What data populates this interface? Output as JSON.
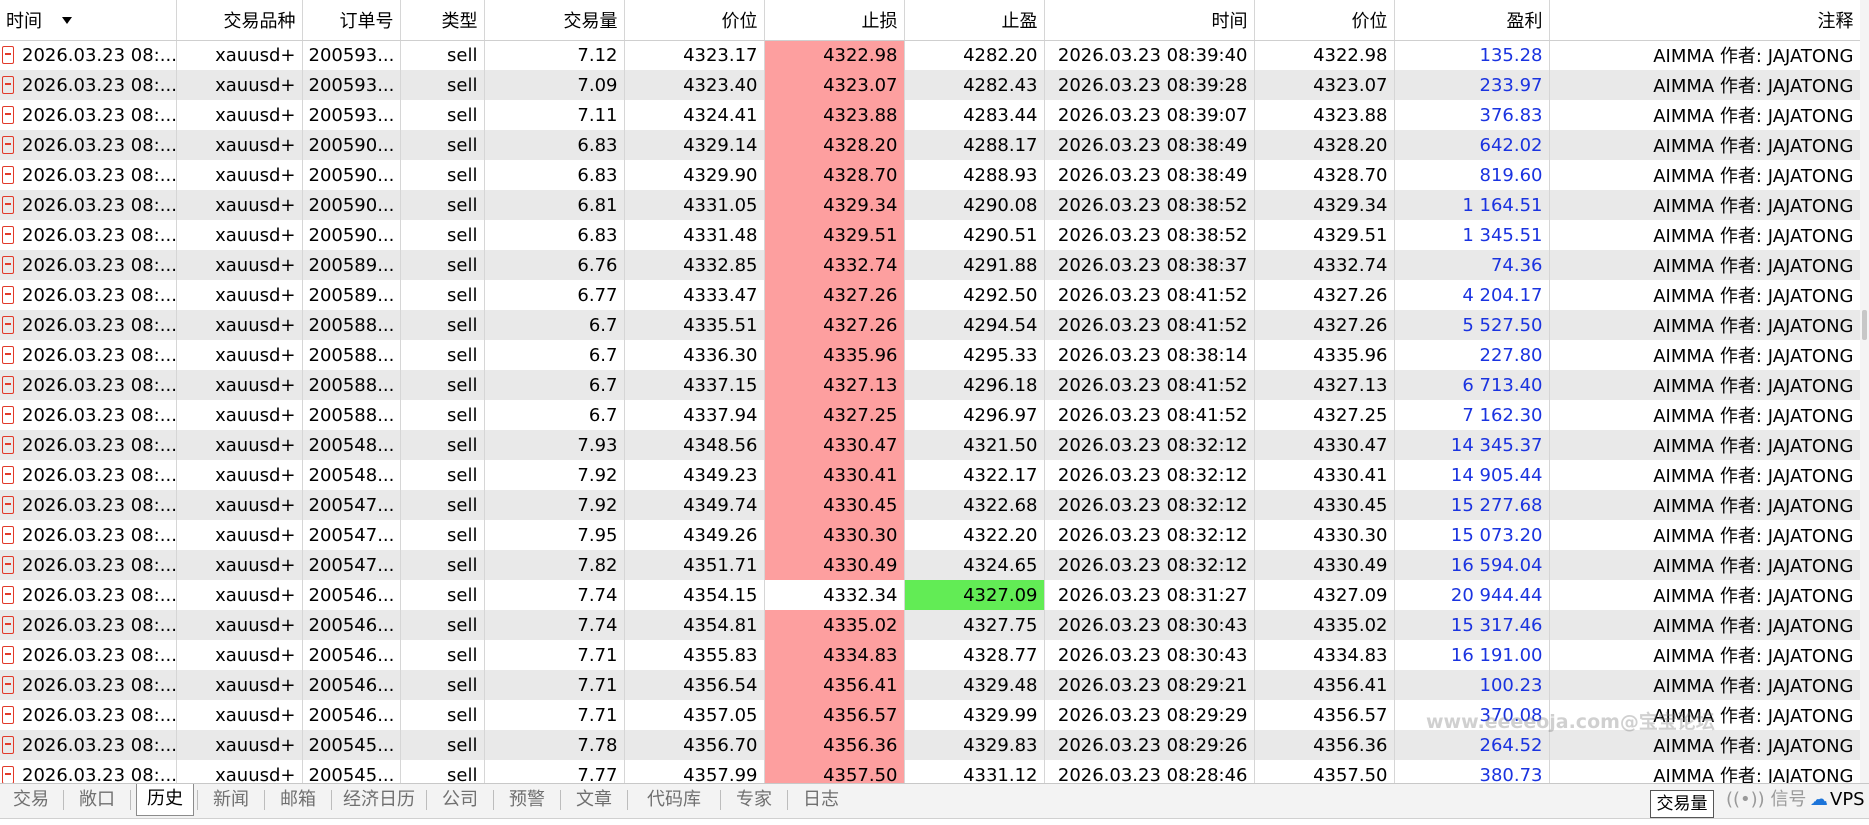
{
  "columns": [
    "时间",
    "交易品种",
    "订单号",
    "类型",
    "交易量",
    "价位",
    "止损",
    "止盈",
    "时间",
    "价位",
    "盈利",
    "注释"
  ],
  "rows": [
    {
      "open_time": "2026.03.23 08:...",
      "symbol": "xauusd+",
      "order": "200593...",
      "type": "sell",
      "volume": "7.12",
      "open_price": "4323.17",
      "sl": "4322.98",
      "tp": "4282.20",
      "close_time": "2026.03.23 08:39:40",
      "close_price": "4322.98",
      "profit": "135.28",
      "comment": "AIMMA 作者: JAJATONG",
      "sl_hit": true,
      "tp_hit": false
    },
    {
      "open_time": "2026.03.23 08:...",
      "symbol": "xauusd+",
      "order": "200593...",
      "type": "sell",
      "volume": "7.09",
      "open_price": "4323.40",
      "sl": "4323.07",
      "tp": "4282.43",
      "close_time": "2026.03.23 08:39:28",
      "close_price": "4323.07",
      "profit": "233.97",
      "comment": "AIMMA 作者: JAJATONG",
      "sl_hit": true,
      "tp_hit": false
    },
    {
      "open_time": "2026.03.23 08:...",
      "symbol": "xauusd+",
      "order": "200593...",
      "type": "sell",
      "volume": "7.11",
      "open_price": "4324.41",
      "sl": "4323.88",
      "tp": "4283.44",
      "close_time": "2026.03.23 08:39:07",
      "close_price": "4323.88",
      "profit": "376.83",
      "comment": "AIMMA 作者: JAJATONG",
      "sl_hit": true,
      "tp_hit": false
    },
    {
      "open_time": "2026.03.23 08:...",
      "symbol": "xauusd+",
      "order": "200590...",
      "type": "sell",
      "volume": "6.83",
      "open_price": "4329.14",
      "sl": "4328.20",
      "tp": "4288.17",
      "close_time": "2026.03.23 08:38:49",
      "close_price": "4328.20",
      "profit": "642.02",
      "comment": "AIMMA 作者: JAJATONG",
      "sl_hit": true,
      "tp_hit": false
    },
    {
      "open_time": "2026.03.23 08:...",
      "symbol": "xauusd+",
      "order": "200590...",
      "type": "sell",
      "volume": "6.83",
      "open_price": "4329.90",
      "sl": "4328.70",
      "tp": "4288.93",
      "close_time": "2026.03.23 08:38:49",
      "close_price": "4328.70",
      "profit": "819.60",
      "comment": "AIMMA 作者: JAJATONG",
      "sl_hit": true,
      "tp_hit": false
    },
    {
      "open_time": "2026.03.23 08:...",
      "symbol": "xauusd+",
      "order": "200590...",
      "type": "sell",
      "volume": "6.81",
      "open_price": "4331.05",
      "sl": "4329.34",
      "tp": "4290.08",
      "close_time": "2026.03.23 08:38:52",
      "close_price": "4329.34",
      "profit": "1 164.51",
      "comment": "AIMMA 作者: JAJATONG",
      "sl_hit": true,
      "tp_hit": false
    },
    {
      "open_time": "2026.03.23 08:...",
      "symbol": "xauusd+",
      "order": "200590...",
      "type": "sell",
      "volume": "6.83",
      "open_price": "4331.48",
      "sl": "4329.51",
      "tp": "4290.51",
      "close_time": "2026.03.23 08:38:52",
      "close_price": "4329.51",
      "profit": "1 345.51",
      "comment": "AIMMA 作者: JAJATONG",
      "sl_hit": true,
      "tp_hit": false
    },
    {
      "open_time": "2026.03.23 08:...",
      "symbol": "xauusd+",
      "order": "200589...",
      "type": "sell",
      "volume": "6.76",
      "open_price": "4332.85",
      "sl": "4332.74",
      "tp": "4291.88",
      "close_time": "2026.03.23 08:38:37",
      "close_price": "4332.74",
      "profit": "74.36",
      "comment": "AIMMA 作者: JAJATONG",
      "sl_hit": true,
      "tp_hit": false
    },
    {
      "open_time": "2026.03.23 08:...",
      "symbol": "xauusd+",
      "order": "200589...",
      "type": "sell",
      "volume": "6.77",
      "open_price": "4333.47",
      "sl": "4327.26",
      "tp": "4292.50",
      "close_time": "2026.03.23 08:41:52",
      "close_price": "4327.26",
      "profit": "4 204.17",
      "comment": "AIMMA 作者: JAJATONG",
      "sl_hit": true,
      "tp_hit": false
    },
    {
      "open_time": "2026.03.23 08:...",
      "symbol": "xauusd+",
      "order": "200588...",
      "type": "sell",
      "volume": "6.7",
      "open_price": "4335.51",
      "sl": "4327.26",
      "tp": "4294.54",
      "close_time": "2026.03.23 08:41:52",
      "close_price": "4327.26",
      "profit": "5 527.50",
      "comment": "AIMMA 作者: JAJATONG",
      "sl_hit": true,
      "tp_hit": false
    },
    {
      "open_time": "2026.03.23 08:...",
      "symbol": "xauusd+",
      "order": "200588...",
      "type": "sell",
      "volume": "6.7",
      "open_price": "4336.30",
      "sl": "4335.96",
      "tp": "4295.33",
      "close_time": "2026.03.23 08:38:14",
      "close_price": "4335.96",
      "profit": "227.80",
      "comment": "AIMMA 作者: JAJATONG",
      "sl_hit": true,
      "tp_hit": false
    },
    {
      "open_time": "2026.03.23 08:...",
      "symbol": "xauusd+",
      "order": "200588...",
      "type": "sell",
      "volume": "6.7",
      "open_price": "4337.15",
      "sl": "4327.13",
      "tp": "4296.18",
      "close_time": "2026.03.23 08:41:52",
      "close_price": "4327.13",
      "profit": "6 713.40",
      "comment": "AIMMA 作者: JAJATONG",
      "sl_hit": true,
      "tp_hit": false
    },
    {
      "open_time": "2026.03.23 08:...",
      "symbol": "xauusd+",
      "order": "200588...",
      "type": "sell",
      "volume": "6.7",
      "open_price": "4337.94",
      "sl": "4327.25",
      "tp": "4296.97",
      "close_time": "2026.03.23 08:41:52",
      "close_price": "4327.25",
      "profit": "7 162.30",
      "comment": "AIMMA 作者: JAJATONG",
      "sl_hit": true,
      "tp_hit": false
    },
    {
      "open_time": "2026.03.23 08:...",
      "symbol": "xauusd+",
      "order": "200548...",
      "type": "sell",
      "volume": "7.93",
      "open_price": "4348.56",
      "sl": "4330.47",
      "tp": "4321.50",
      "close_time": "2026.03.23 08:32:12",
      "close_price": "4330.47",
      "profit": "14 345.37",
      "comment": "AIMMA 作者: JAJATONG",
      "sl_hit": true,
      "tp_hit": false
    },
    {
      "open_time": "2026.03.23 08:...",
      "symbol": "xauusd+",
      "order": "200548...",
      "type": "sell",
      "volume": "7.92",
      "open_price": "4349.23",
      "sl": "4330.41",
      "tp": "4322.17",
      "close_time": "2026.03.23 08:32:12",
      "close_price": "4330.41",
      "profit": "14 905.44",
      "comment": "AIMMA 作者: JAJATONG",
      "sl_hit": true,
      "tp_hit": false
    },
    {
      "open_time": "2026.03.23 08:...",
      "symbol": "xauusd+",
      "order": "200547...",
      "type": "sell",
      "volume": "7.92",
      "open_price": "4349.74",
      "sl": "4330.45",
      "tp": "4322.68",
      "close_time": "2026.03.23 08:32:12",
      "close_price": "4330.45",
      "profit": "15 277.68",
      "comment": "AIMMA 作者: JAJATONG",
      "sl_hit": true,
      "tp_hit": false
    },
    {
      "open_time": "2026.03.23 08:...",
      "symbol": "xauusd+",
      "order": "200547...",
      "type": "sell",
      "volume": "7.95",
      "open_price": "4349.26",
      "sl": "4330.30",
      "tp": "4322.20",
      "close_time": "2026.03.23 08:32:12",
      "close_price": "4330.30",
      "profit": "15 073.20",
      "comment": "AIMMA 作者: JAJATONG",
      "sl_hit": true,
      "tp_hit": false
    },
    {
      "open_time": "2026.03.23 08:...",
      "symbol": "xauusd+",
      "order": "200547...",
      "type": "sell",
      "volume": "7.82",
      "open_price": "4351.71",
      "sl": "4330.49",
      "tp": "4324.65",
      "close_time": "2026.03.23 08:32:12",
      "close_price": "4330.49",
      "profit": "16 594.04",
      "comment": "AIMMA 作者: JAJATONG",
      "sl_hit": true,
      "tp_hit": false
    },
    {
      "open_time": "2026.03.23 08:...",
      "symbol": "xauusd+",
      "order": "200546...",
      "type": "sell",
      "volume": "7.74",
      "open_price": "4354.15",
      "sl": "4332.34",
      "tp": "4327.09",
      "close_time": "2026.03.23 08:31:27",
      "close_price": "4327.09",
      "profit": "20 944.44",
      "comment": "AIMMA 作者: JAJATONG",
      "sl_hit": false,
      "tp_hit": true
    },
    {
      "open_time": "2026.03.23 08:...",
      "symbol": "xauusd+",
      "order": "200546...",
      "type": "sell",
      "volume": "7.74",
      "open_price": "4354.81",
      "sl": "4335.02",
      "tp": "4327.75",
      "close_time": "2026.03.23 08:30:43",
      "close_price": "4335.02",
      "profit": "15 317.46",
      "comment": "AIMMA 作者: JAJATONG",
      "sl_hit": true,
      "tp_hit": false
    },
    {
      "open_time": "2026.03.23 08:...",
      "symbol": "xauusd+",
      "order": "200546...",
      "type": "sell",
      "volume": "7.71",
      "open_price": "4355.83",
      "sl": "4334.83",
      "tp": "4328.77",
      "close_time": "2026.03.23 08:30:43",
      "close_price": "4334.83",
      "profit": "16 191.00",
      "comment": "AIMMA 作者: JAJATONG",
      "sl_hit": true,
      "tp_hit": false
    },
    {
      "open_time": "2026.03.23 08:...",
      "symbol": "xauusd+",
      "order": "200546...",
      "type": "sell",
      "volume": "7.71",
      "open_price": "4356.54",
      "sl": "4356.41",
      "tp": "4329.48",
      "close_time": "2026.03.23 08:29:21",
      "close_price": "4356.41",
      "profit": "100.23",
      "comment": "AIMMA 作者: JAJATONG",
      "sl_hit": true,
      "tp_hit": false
    },
    {
      "open_time": "2026.03.23 08:...",
      "symbol": "xauusd+",
      "order": "200546...",
      "type": "sell",
      "volume": "7.71",
      "open_price": "4357.05",
      "sl": "4356.57",
      "tp": "4329.99",
      "close_time": "2026.03.23 08:29:29",
      "close_price": "4356.57",
      "profit": "370.08",
      "comment": "AIMMA 作者: JAJATONG",
      "sl_hit": true,
      "tp_hit": false
    },
    {
      "open_time": "2026.03.23 08:...",
      "symbol": "xauusd+",
      "order": "200545...",
      "type": "sell",
      "volume": "7.78",
      "open_price": "4356.70",
      "sl": "4356.36",
      "tp": "4329.83",
      "close_time": "2026.03.23 08:29:26",
      "close_price": "4356.36",
      "profit": "264.52",
      "comment": "AIMMA 作者: JAJATONG",
      "sl_hit": true,
      "tp_hit": false
    },
    {
      "open_time": "2026.03.23 08:...",
      "symbol": "xauusd+",
      "order": "200545...",
      "type": "sell",
      "volume": "7.77",
      "open_price": "4357.99",
      "sl": "4357.50",
      "tp": "4331.12",
      "close_time": "2026.03.23 08:28:46",
      "close_price": "4357.50",
      "profit": "380.73",
      "comment": "AIMMA 作者: JAJATONG",
      "sl_hit": true,
      "tp_hit": false
    }
  ],
  "tabs": [
    "交易",
    "敞口",
    "历史",
    "新闻",
    "邮箱",
    "经济日历",
    "公司",
    "预警",
    "文章",
    "代码库",
    "专家",
    "日志"
  ],
  "active_tab": "历史",
  "status": {
    "volume_button": "交易量",
    "signal": "信号",
    "vps": "VPS"
  },
  "watermark": "www.eeeeoja.com@宝宝论坛",
  "colors": {
    "sl_hit": "#fd9f9f",
    "tp_hit": "#62ec55",
    "profit": "#1a33e0",
    "alt_row": "#e9e9e9"
  }
}
